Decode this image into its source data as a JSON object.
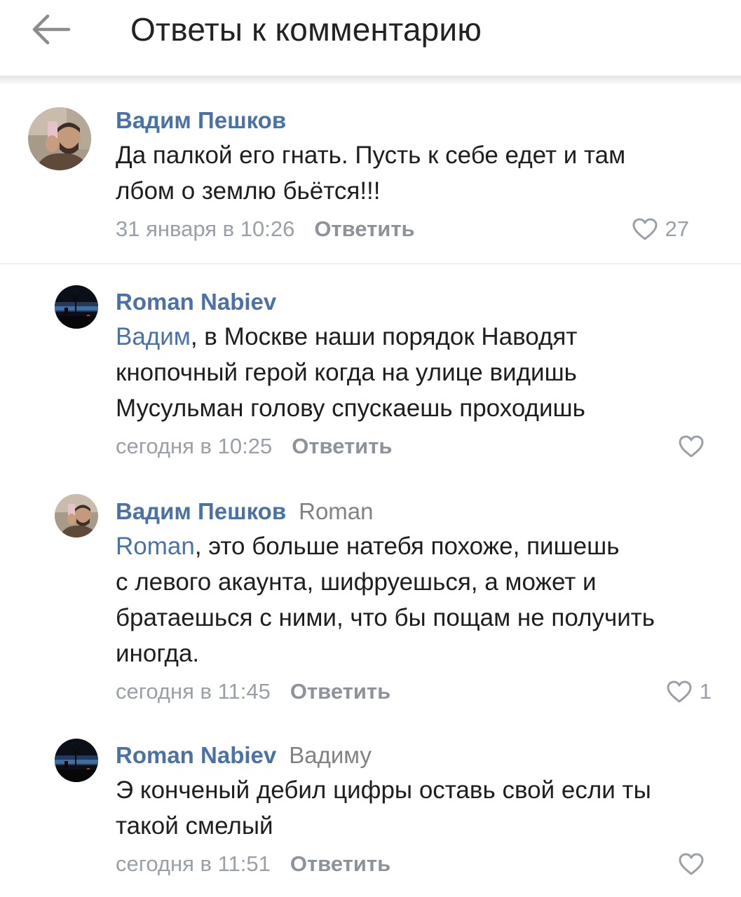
{
  "header": {
    "back_icon": "arrow-left-icon",
    "title": "Ответы к комментарию"
  },
  "comments": [
    {
      "author": "Вадим Пешков",
      "reply_to": "",
      "mention": "",
      "lines": [
        "Да палкой его гнать. Пусть к себе едет и там",
        "лбом о землю бьётся!!!"
      ],
      "date": "31 января в 10:26",
      "reply_label": "Ответить",
      "likes": "27",
      "like_icon": "heart-outline-icon"
    },
    {
      "author": "Roman Nabiev",
      "reply_to": "",
      "mention": "Вадим",
      "lines": [
        ", в Москве наши порядок Наводят",
        "кнопочный герой когда на улице видишь",
        "Мусульман голову спускаешь проходишь"
      ],
      "date": "сегодня в 10:25",
      "reply_label": "Ответить",
      "likes": "",
      "like_icon": "heart-outline-icon"
    },
    {
      "author": "Вадим Пешков",
      "reply_to": "Roman",
      "mention": "Roman",
      "lines": [
        ", это больше натебя похоже, пишешь",
        "с левого акаунта, шифруешься, а может и",
        "братаешься с ними, что бы пощам не получить",
        "иногда."
      ],
      "date": "сегодня в 11:45",
      "reply_label": "Ответить",
      "likes": "1",
      "like_icon": "heart-outline-icon"
    },
    {
      "author": "Roman Nabiev",
      "reply_to": "Вадиму",
      "mention": "",
      "lines": [
        "Э конченый дебил цифры оставь свой если ты",
        "такой смелый"
      ],
      "date": "сегодня в 11:51",
      "reply_label": "Ответить",
      "likes": "",
      "like_icon": "heart-outline-icon"
    }
  ],
  "colors": {
    "link": "#4a72a5",
    "text": "#1e1e1e",
    "meta": "#9aa0a8",
    "divider": "#e2e3e6"
  }
}
